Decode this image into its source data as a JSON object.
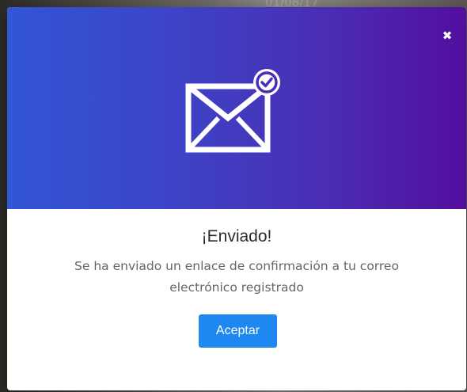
{
  "background": {
    "partial_text": "01/08/17"
  },
  "modal": {
    "close_label": "✖",
    "icon": "envelope-check-icon",
    "title": "¡Enviado!",
    "message": "Se ha enviado un enlace de confirmación a tu correo electrónico registrado",
    "accept_label": "Aceptar"
  },
  "colors": {
    "header_gradient_start": "#3156d6",
    "header_gradient_end": "#530e9e",
    "button": "#1e88f0",
    "title": "#2b2b2b",
    "message": "#666666"
  }
}
